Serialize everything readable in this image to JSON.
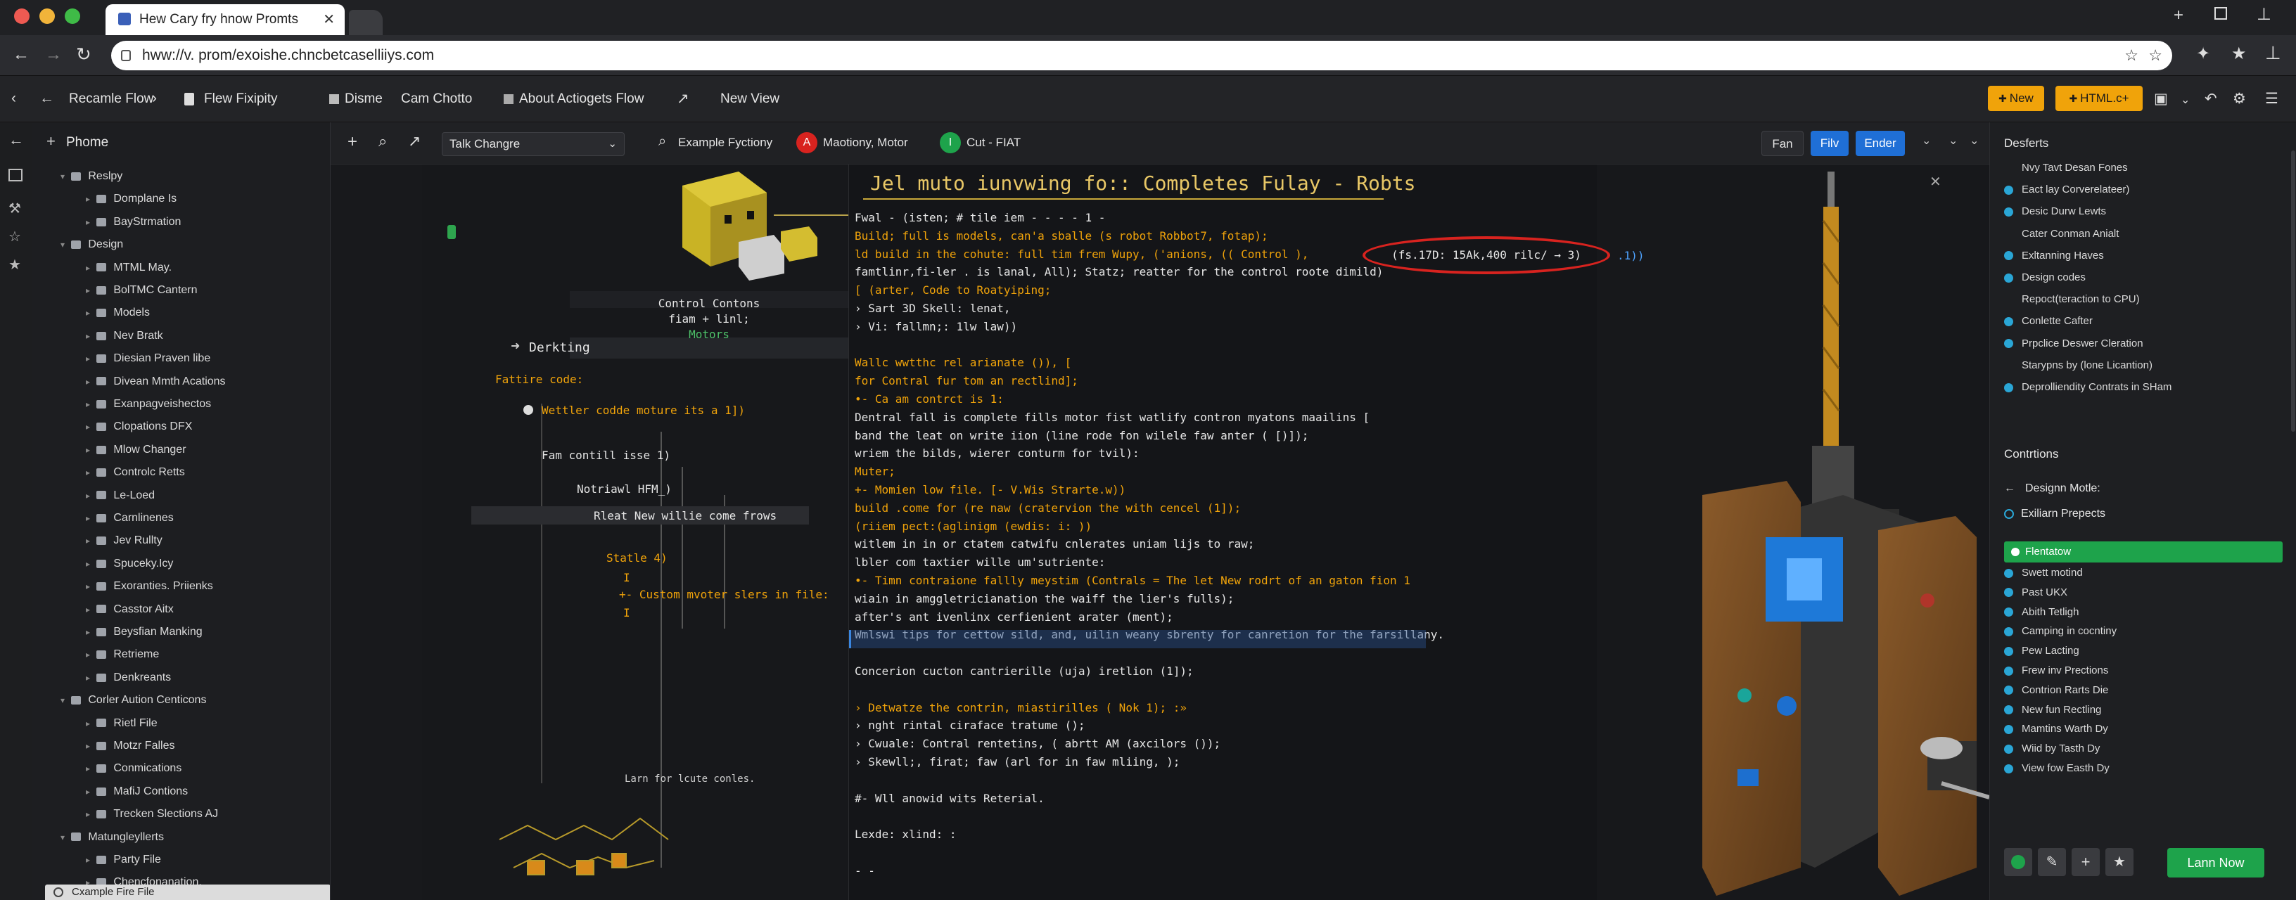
{
  "browser": {
    "tab_title": "Hew Cary fry hnow Promts",
    "url": "hww://v. prom/exoishe.chncbetcaselliiys.com"
  },
  "app_toolbar": {
    "items": [
      "Recamle Flow",
      "Flew Fixipity",
      "Disme",
      "Cam Chotto",
      "About Actiogets Flow",
      "New View"
    ],
    "new_label": "New",
    "html_label": "HTML.c+"
  },
  "sidebar": {
    "header": "Phome",
    "items": [
      {
        "label": "Reslpy",
        "level": 0
      },
      {
        "label": "Domplane Is",
        "level": 1
      },
      {
        "label": "BayStrmation",
        "level": 1
      },
      {
        "label": "Design",
        "level": 0
      },
      {
        "label": "MTML May.",
        "level": 1
      },
      {
        "label": "BolTMC Cantern",
        "level": 1
      },
      {
        "label": "Models",
        "level": 1
      },
      {
        "label": "Nev Bratk",
        "level": 1
      },
      {
        "label": "Diesian Praven libe",
        "level": 1
      },
      {
        "label": "Divean Mmth Acations",
        "level": 1
      },
      {
        "label": "Exanpagveishectos",
        "level": 1
      },
      {
        "label": "Clopations DFX",
        "level": 1
      },
      {
        "label": "Mlow Changer",
        "level": 1
      },
      {
        "label": "Controlc Retts",
        "level": 1
      },
      {
        "label": "Le-Loed",
        "level": 1
      },
      {
        "label": "Carnlinenes",
        "level": 1
      },
      {
        "label": "Jev Rullty",
        "level": 1
      },
      {
        "label": "Spuceky.Icy",
        "level": 1
      },
      {
        "label": "Exoranties. Priienks",
        "level": 1
      },
      {
        "label": "Casstor Aitx",
        "level": 1
      },
      {
        "label": "Beysfian Manking",
        "level": 1
      },
      {
        "label": "Retrieme",
        "level": 1
      },
      {
        "label": "Denkreants",
        "level": 1
      },
      {
        "label": "Corler Aution Centicons",
        "level": 0
      },
      {
        "label": "Rietl File",
        "level": 1
      },
      {
        "label": "Motzr Falles",
        "level": 1
      },
      {
        "label": "Conmications",
        "level": 1
      },
      {
        "label": "MafiJ Contions",
        "level": 1
      },
      {
        "label": "Trecken Slections AJ",
        "level": 1
      },
      {
        "label": "Matungleyllerts",
        "level": 0
      },
      {
        "label": "Party File",
        "level": 1
      },
      {
        "label": "Chencfonanation.",
        "level": 1
      }
    ],
    "footer_file": "Cxample Fire File"
  },
  "canvas_toolbar": {
    "dropdown": "Talk Changre",
    "example": "Example Fyctiony",
    "motor": "Maotiony, Motor",
    "cut": "Cut - FIAT",
    "fan": "Fan",
    "fily": "Filv",
    "ender": "Ender"
  },
  "node_panel": {
    "caption1": "Control Contons",
    "caption2": "fiam + linl;",
    "caption3": "Motors",
    "section": "Derkting",
    "feature_code": "Fattire code:",
    "line1": "Wettler codde moture its a 1])",
    "line2": "Fam contill isse 1)",
    "line3": "Notriawl HFM_)",
    "line4": "Rleat New willie come frows",
    "line5": "Statle 4)",
    "line6": "I",
    "line7": "+- Custom mvoter slers in file:",
    "line8": "I",
    "bottom": "Larn for lcute conles."
  },
  "editor": {
    "title": "Jel muto iunvwing fo:: Completes Fulay - Robts",
    "lines": [
      "Fwal     -    (isten;  # tile iem  - - - - 1 -",
      "Build; full is models, can'a sballe (s robot Robbot7, fotap);",
      "ld build in the cohute: full tim frem Wupy, ('anions, (( Control ), ",
      "famtlinr,fi-ler . is lanal, All); Statz; reatter for the control roote dimild)",
      "[          (arter, Code to Roatyiping;",
      "› Sart 3D Skell: lenat,",
      "› Vi: fallmn;: 1lw law))",
      "",
      "Wallc wwtthc rel arianate ()), [",
      "for Contral fur tom an rectlind];",
      "•- Ca am contrct is 1:",
      "   Dentral fall is complete fills motor fist watlify contron myatons maailins [",
      "   band the leat on write iion (line rode fon wilele faw anter ( [)]);",
      "   wriem the bilds, wierer conturm for tvil):",
      "   Muter;",
      "+- Momien low file. [-   V.Wis Strarte.w))",
      "build .come for (re naw (cratervion the with cencel (1]);",
      "(riiem pect:(aglinigm (ewdis: i: ))",
      "witlem in in or ctatem catwifu cnlerates uniam lijs to raw;",
      "lbler com taxtier wille um'sutriente:",
      "•- Timn contraione fallly meystim (Contrals = The let New rodrt of an gaton fion 1",
      "wiain in amggletricianation the waiff the lier's fulls);",
      " after's ant ivenlinx cerfienient arater (ment);",
      "Wmlswi tips for cettow sild, and, uilin weany sbrenty for canretion for the farsillany.",
      "",
      "Concerion cucton cantrierille (uja) iretlion (1]);",
      "",
      "› Detwatze the contrin, miastirilles ( Nok 1); :»",
      "› nght rintal ciraface tratume ();",
      "› Cwuale: Contral rentetins, ( abrtt AM (axcilors ());",
      "› Skewll;, firat; faw (arl for in faw mliing, );",
      "",
      "#- Wll anowid wits Reterial.",
      "",
      "Lexde:                                xlind: :",
      "",
      "- -"
    ],
    "highlight": "(fs.17D: 15Ak,400 rilc/ → 3)",
    "highlight_suffix": "  .1))"
  },
  "right_panel": {
    "header": "Desferts",
    "top_items": [
      "Nvy Tavt Desan Fones",
      "Eact lay Corverelateer)",
      "Desic Durw Lewts",
      "Cater Conman Anialt",
      "Exltanning Haves",
      "Design codes",
      "Repoct(teraction to CPU)",
      "Conlette Cafter",
      "Prpclice Deswer Cleration",
      "Starypns by (lone Licantion)",
      "Deprolliendity Contrats in SHam"
    ],
    "controls_header": "Contrtions",
    "design_mode": "Designn Motle:",
    "projects": "Exiliarn Prepects",
    "active_item": "Flentatow",
    "list": [
      "Swett motind",
      "Past UKX",
      "Abith Tetligh",
      "Camping in cocntiny",
      "Pew Lacting",
      "Frew inv Prections",
      "Contrion Rarts Die",
      "New fun Rectling",
      "Mamtins Warth Dy",
      "Wiid by Tasth Dy",
      "View fow Easth Dy"
    ],
    "learn_now": "Lann Now"
  },
  "colors": {
    "accent_orange": "#f0a30a",
    "accent_green": "#1ea34b",
    "accent_blue": "#1f6fd6",
    "highlight_red": "#d8231f"
  }
}
